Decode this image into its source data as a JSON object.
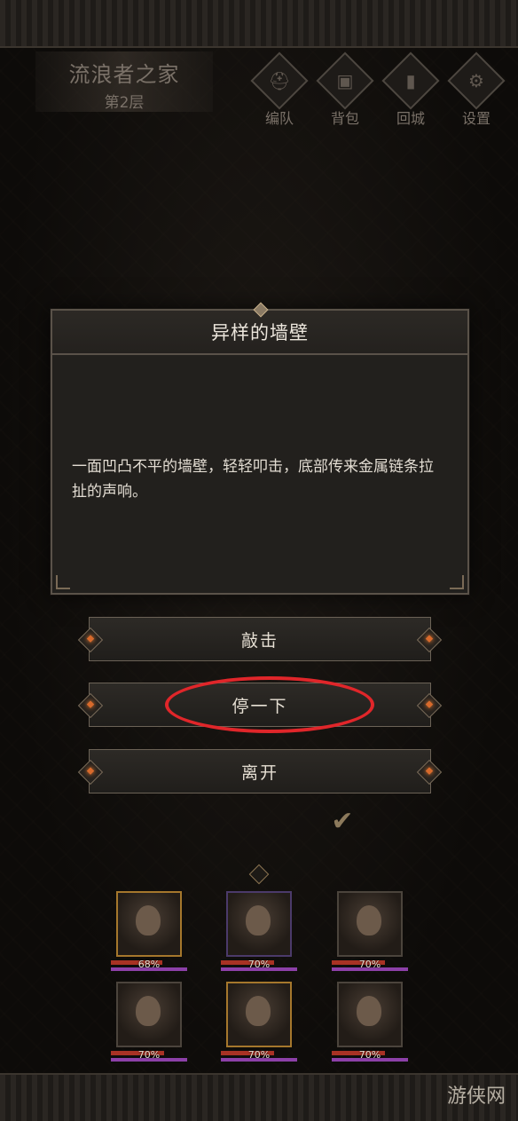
{
  "header": {
    "location_name": "流浪者之家",
    "floor": "第2层",
    "buttons": [
      {
        "label": "编队",
        "icon": "helmet-icon"
      },
      {
        "label": "背包",
        "icon": "bag-icon"
      },
      {
        "label": "回城",
        "icon": "door-icon"
      },
      {
        "label": "设置",
        "icon": "gear-icon"
      }
    ]
  },
  "dialog": {
    "title": "异样的墙壁",
    "text": "一面凹凸不平的墙壁，轻轻叩击，底部传来金属链条拉扯的声响。"
  },
  "options": [
    {
      "label": "敲击"
    },
    {
      "label": "停一下"
    },
    {
      "label": "离开"
    }
  ],
  "highlight_color": "#e0262a",
  "party": [
    {
      "hp_percent": "68%",
      "hp": 0.68,
      "frame": "rare"
    },
    {
      "hp_percent": "70%",
      "hp": 0.7,
      "frame": "epic"
    },
    {
      "hp_percent": "70%",
      "hp": 0.7,
      "frame": "normal"
    },
    {
      "hp_percent": "70%",
      "hp": 0.7,
      "frame": "normal"
    },
    {
      "hp_percent": "70%",
      "hp": 0.7,
      "frame": "rare"
    },
    {
      "hp_percent": "70%",
      "hp": 0.7,
      "frame": "normal"
    }
  ],
  "watermark": "游侠网"
}
